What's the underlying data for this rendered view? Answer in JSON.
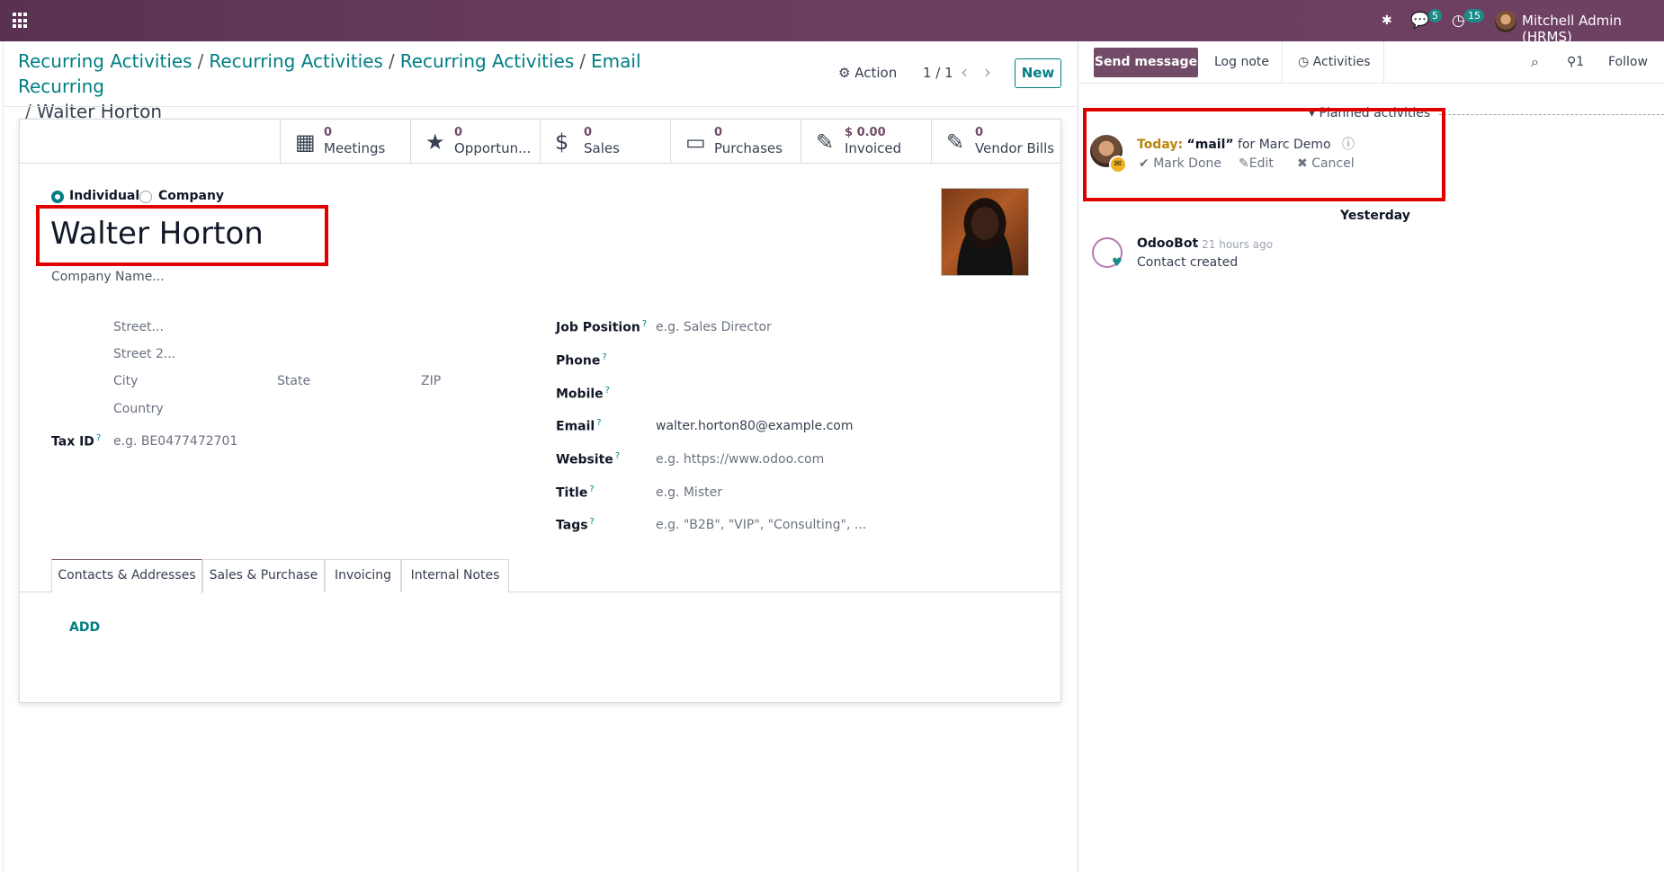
{
  "navbar": {
    "discuss_count": "5",
    "activity_count": "15",
    "user_name": "Mitchell Admin (HRMS)"
  },
  "breadcrumb": {
    "items": [
      "Recurring Activities",
      "Recurring Activities",
      "Recurring Activities",
      "Email Recurring"
    ],
    "separator": "/",
    "current": "Walter Horton"
  },
  "control": {
    "action_label": "Action",
    "pager": "1 / 1",
    "new_label": "New"
  },
  "smart_buttons": [
    {
      "icon": "calendar-icon",
      "value": "0",
      "label": "Meetings"
    },
    {
      "icon": "star-icon",
      "value": "0",
      "label": "Opportun..."
    },
    {
      "icon": "dollar-icon",
      "value": "0",
      "label": "Sales"
    },
    {
      "icon": "credit-card-icon",
      "value": "0",
      "label": "Purchases"
    },
    {
      "icon": "pencil-square-icon",
      "value": "$ 0.00",
      "label": "Invoiced"
    },
    {
      "icon": "pencil-square-icon",
      "value": "0",
      "label": "Vendor Bills"
    }
  ],
  "form": {
    "type_individual": "Individual",
    "type_company": "Company",
    "name": "Walter Horton",
    "company_placeholder": "Company Name...",
    "address": {
      "street": "Street...",
      "street2": "Street 2...",
      "city": "City",
      "state": "State",
      "zip": "ZIP",
      "country": "Country"
    },
    "tax_id_label": "Tax ID",
    "tax_id_placeholder": "e.g. BE0477472701",
    "job_position_label": "Job Position",
    "job_position_placeholder": "e.g. Sales Director",
    "phone_label": "Phone",
    "mobile_label": "Mobile",
    "email_label": "Email",
    "email_value": "walter.horton80@example.com",
    "website_label": "Website",
    "website_placeholder": "e.g. https://www.odoo.com",
    "title_label": "Title",
    "title_placeholder": "e.g. Mister",
    "tags_label": "Tags",
    "tags_placeholder": "e.g. \"B2B\", \"VIP\", \"Consulting\", ...",
    "help_mark": "?"
  },
  "tabs": [
    "Contacts & Addresses",
    "Sales & Purchase",
    "Invoicing",
    "Internal Notes"
  ],
  "add_label": "ADD",
  "chatter": {
    "send_message": "Send message",
    "log_note": "Log note",
    "activities": "Activities",
    "followers_count": "1",
    "follow": "Follow",
    "planned_label": "Planned activities",
    "activity": {
      "today": "Today:",
      "summary": "“mail”",
      "for_text": "for Marc Demo",
      "mark_done": "Mark Done",
      "edit": "Edit",
      "cancel": "Cancel"
    },
    "date_separator": "Yesterday",
    "message": {
      "author": "OdooBot",
      "time": "- 21 hours ago",
      "body": "Contact created"
    }
  },
  "colors": {
    "brand": "#714b67",
    "accent": "#017e84",
    "highlight": "#e00000"
  }
}
